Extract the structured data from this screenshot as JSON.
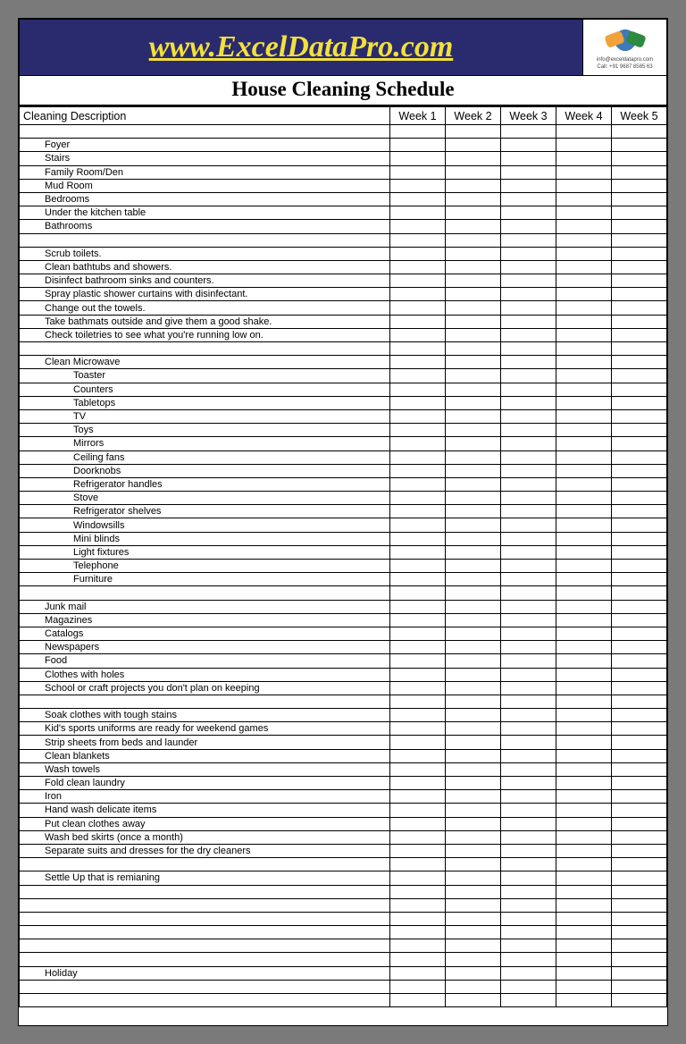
{
  "header": {
    "site_url": "www.ExcelDataPro.com",
    "contact_email": "info@exceldatapro.com",
    "contact_phone": "Call: +91 9687 8585 63"
  },
  "title": "House Cleaning Schedule",
  "columns": {
    "description": "Cleaning Description",
    "weeks": [
      "Week 1",
      "Week 2",
      "Week 3",
      "Week 4",
      "Week 5"
    ]
  },
  "rows": [
    {
      "text": "",
      "indent": 0
    },
    {
      "text": "Foyer",
      "indent": 1
    },
    {
      "text": "Stairs",
      "indent": 1
    },
    {
      "text": "Family Room/Den",
      "indent": 1
    },
    {
      "text": "Mud Room",
      "indent": 1
    },
    {
      "text": "Bedrooms",
      "indent": 1
    },
    {
      "text": "Under the kitchen table",
      "indent": 1
    },
    {
      "text": "Bathrooms",
      "indent": 1
    },
    {
      "text": "",
      "indent": 0
    },
    {
      "text": "Scrub toilets.",
      "indent": 1
    },
    {
      "text": "Clean bathtubs and showers.",
      "indent": 1
    },
    {
      "text": "Disinfect bathroom sinks and counters.",
      "indent": 1
    },
    {
      "text": "Spray plastic shower curtains with disinfectant.",
      "indent": 1
    },
    {
      "text": "Change out the towels.",
      "indent": 1
    },
    {
      "text": "Take bathmats outside and give them a good shake.",
      "indent": 1
    },
    {
      "text": "Check toiletries to see what you're running low on.",
      "indent": 1
    },
    {
      "text": "",
      "indent": 0
    },
    {
      "text": "Clean Microwave",
      "indent": 1
    },
    {
      "text": "Toaster",
      "indent": 2
    },
    {
      "text": "Counters",
      "indent": 2
    },
    {
      "text": "Tabletops",
      "indent": 2
    },
    {
      "text": "TV",
      "indent": 2
    },
    {
      "text": "Toys",
      "indent": 2
    },
    {
      "text": "Mirrors",
      "indent": 2
    },
    {
      "text": "Ceiling fans",
      "indent": 2
    },
    {
      "text": "Doorknobs",
      "indent": 2
    },
    {
      "text": "Refrigerator handles",
      "indent": 2
    },
    {
      "text": "Stove",
      "indent": 2
    },
    {
      "text": "Refrigerator shelves",
      "indent": 2
    },
    {
      "text": "Windowsills",
      "indent": 2
    },
    {
      "text": "Mini blinds",
      "indent": 2
    },
    {
      "text": "Light fixtures",
      "indent": 2
    },
    {
      "text": "Telephone",
      "indent": 2
    },
    {
      "text": "Furniture",
      "indent": 2
    },
    {
      "text": "",
      "indent": 0
    },
    {
      "text": "Junk mail",
      "indent": 1
    },
    {
      "text": "Magazines",
      "indent": 1
    },
    {
      "text": "Catalogs",
      "indent": 1
    },
    {
      "text": "Newspapers",
      "indent": 1
    },
    {
      "text": "Food",
      "indent": 1
    },
    {
      "text": "Clothes with holes",
      "indent": 1
    },
    {
      "text": "School or craft projects you don't plan on keeping",
      "indent": 1
    },
    {
      "text": "",
      "indent": 0
    },
    {
      "text": "Soak clothes with tough stains",
      "indent": 1
    },
    {
      "text": "Kid's sports uniforms are ready for weekend games",
      "indent": 1
    },
    {
      "text": "Strip sheets from beds and launder",
      "indent": 1
    },
    {
      "text": "Clean blankets",
      "indent": 1
    },
    {
      "text": "Wash towels",
      "indent": 1
    },
    {
      "text": "Fold clean laundry",
      "indent": 1
    },
    {
      "text": "Iron",
      "indent": 1
    },
    {
      "text": "Hand wash delicate items",
      "indent": 1
    },
    {
      "text": "Put clean clothes away",
      "indent": 1
    },
    {
      "text": "Wash bed skirts (once a month)",
      "indent": 1
    },
    {
      "text": "Separate suits and dresses for the dry cleaners",
      "indent": 1
    },
    {
      "text": "",
      "indent": 0
    },
    {
      "text": "Settle Up that is remianing",
      "indent": 1
    },
    {
      "text": "",
      "indent": 0
    },
    {
      "text": "",
      "indent": 0
    },
    {
      "text": "",
      "indent": 0
    },
    {
      "text": "",
      "indent": 0
    },
    {
      "text": "",
      "indent": 0
    },
    {
      "text": "",
      "indent": 0
    },
    {
      "text": "Holiday",
      "indent": 1
    },
    {
      "text": "",
      "indent": 0
    },
    {
      "text": "",
      "indent": 0
    }
  ]
}
